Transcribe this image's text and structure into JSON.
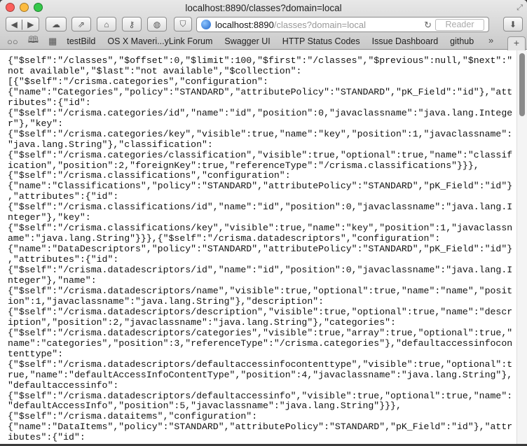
{
  "window": {
    "title": "localhost:8890/classes?domain=local"
  },
  "toolbar": {
    "url_host": "localhost:8890",
    "url_path": "/classes?domain=local",
    "reader_label": "Reader",
    "icons": [
      "back-icon",
      "forward-icon",
      "icloud-icon",
      "share-icon",
      "home-icon",
      "key-icon",
      "ghostery-icon",
      "pocket-icon",
      "reload-icon",
      "download-icon"
    ]
  },
  "bookmarks": {
    "items": [
      "testBild",
      "OS X Maveri...yLink Forum",
      "Swagger UI",
      "HTTP Status Codes",
      "Issue Dashboard",
      "github"
    ],
    "more_label": "»",
    "new_tab_label": "+"
  },
  "content": {
    "lines": [
      "{\"$self\":\"/classes\",\"$offset\":0,\"$limit\":100,\"$first\":\"/classes\",\"$previous\":null,\"$next\":\"",
      "not available\",\"$last\":\"not available\",\"$collection\":",
      "[{\"$self\":\"/crisma.categories\",\"configuration\":",
      "{\"name\":\"Categories\",\"policy\":\"STANDARD\",\"attributePolicy\":\"STANDARD\",\"pK_Field\":\"id\"},\"att",
      "ributes\":{\"id\":",
      "{\"$self\":\"/crisma.categories/id\",\"name\":\"id\",\"position\":0,\"javaclassname\":\"java.lang.Intege",
      "r\"},\"key\":",
      "{\"$self\":\"/crisma.categories/key\",\"visible\":true,\"name\":\"key\",\"position\":1,\"javaclassname\":",
      "\"java.lang.String\"},\"classification\":",
      "{\"$self\":\"/crisma.categories/classification\",\"visible\":true,\"optional\":true,\"name\":\"classif",
      "ication\",\"position\":2,\"foreignKey\":true,\"referenceType\":\"/crisma.classifications\"}}},",
      "{\"$self\":\"/crisma.classifications\",\"configuration\":",
      "{\"name\":\"Classifications\",\"policy\":\"STANDARD\",\"attributePolicy\":\"STANDARD\",\"pK_Field\":\"id\"}",
      ",\"attributes\":{\"id\":",
      "{\"$self\":\"/crisma.classifications/id\",\"name\":\"id\",\"position\":0,\"javaclassname\":\"java.lang.I",
      "nteger\"},\"key\":",
      "{\"$self\":\"/crisma.classifications/key\",\"visible\":true,\"name\":\"key\",\"position\":1,\"javaclassn",
      "ame\":\"java.lang.String\"}}},{\"$self\":\"/crisma.datadescriptors\",\"configuration\":",
      "{\"name\":\"DataDescriptors\",\"policy\":\"STANDARD\",\"attributePolicy\":\"STANDARD\",\"pK_Field\":\"id\"}",
      ",\"attributes\":{\"id\":",
      "{\"$self\":\"/crisma.datadescriptors/id\",\"name\":\"id\",\"position\":0,\"javaclassname\":\"java.lang.I",
      "nteger\"},\"name\":",
      "{\"$self\":\"/crisma.datadescriptors/name\",\"visible\":true,\"optional\":true,\"name\":\"name\",\"posit",
      "ion\":1,\"javaclassname\":\"java.lang.String\"},\"description\":",
      "{\"$self\":\"/crisma.datadescriptors/description\",\"visible\":true,\"optional\":true,\"name\":\"descr",
      "iption\",\"position\":2,\"javaclassname\":\"java.lang.String\"},\"categories\":",
      "{\"$self\":\"/crisma.datadescriptors/categories\",\"visible\":true,\"array\":true,\"optional\":true,\"",
      "name\":\"categories\",\"position\":3,\"referenceType\":\"/crisma.categories\"},\"defaultaccessinfocon",
      "tenttype\":",
      "{\"$self\":\"/crisma.datadescriptors/defaultaccessinfocontenttype\",\"visible\":true,\"optional\":t",
      "rue,\"name\":\"defaultAccessInfoContentType\",\"position\":4,\"javaclassname\":\"java.lang.String\"},",
      "\"defaultaccessinfo\":",
      "{\"$self\":\"/crisma.datadescriptors/defaultaccessinfo\",\"visible\":true,\"optional\":true,\"name\":",
      "\"defaultAccessInfo\",\"position\":5,\"javaclassname\":\"java.lang.String\"}}},",
      "{\"$self\":\"/crisma.dataitems\",\"configuration\":",
      "{\"name\":\"DataItems\",\"policy\":\"STANDARD\",\"attributePolicy\":\"STANDARD\",\"pK_Field\":\"id\"},\"attr",
      "ibutes\":{\"id\":"
    ]
  },
  "colors": {
    "close": "#fc605c",
    "minimize": "#fdbc40",
    "zoom": "#34c84a"
  }
}
